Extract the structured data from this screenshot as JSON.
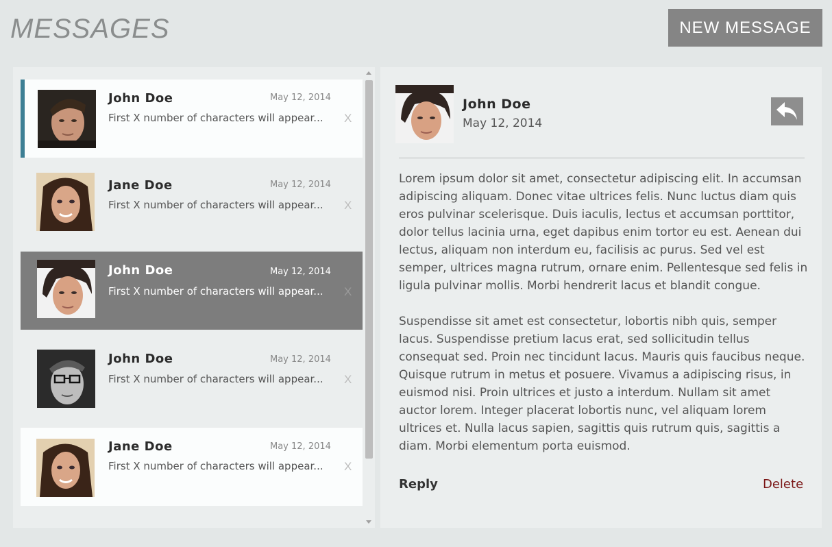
{
  "header": {
    "title": "MESSAGES",
    "new_message_label": "NEW MESSAGE"
  },
  "messages": [
    {
      "name": "John Doe",
      "date": "May 12, 2014",
      "preview": "First X number of characters will appear...",
      "close": "X",
      "avatar": "man-avatar-1"
    },
    {
      "name": "Jane Doe",
      "date": "May 12, 2014",
      "preview": "First X number of characters will appear...",
      "close": "X",
      "avatar": "woman-avatar"
    },
    {
      "name": "John Doe",
      "date": "May 12, 2014",
      "preview": "First X number of characters will appear...",
      "close": "X",
      "avatar": "man-avatar-2"
    },
    {
      "name": "John Doe",
      "date": "May 12, 2014",
      "preview": "First X number of characters will appear...",
      "close": "X",
      "avatar": "man-glasses-avatar"
    },
    {
      "name": "Jane Doe",
      "date": "May 12, 2014",
      "preview": "First X number of characters will appear...",
      "close": "X",
      "avatar": "woman-avatar"
    }
  ],
  "detail": {
    "name": "John Doe",
    "date": "May 12, 2014",
    "paragraphs": [
      "Lorem ipsum dolor sit amet, consectetur adipiscing elit. In accumsan adipiscing aliquam. Donec vitae ultrices felis. Nunc luctus diam quis eros pulvinar scelerisque. Duis iaculis, lectus et accumsan porttitor, dolor tellus lacinia urna, eget dapibus enim tortor eu est. Aenean dui lectus, aliquam non interdum eu, facilisis ac purus. Sed vel est semper, ultrices magna rutrum, ornare enim. Pellentesque sed felis in ligula pulvinar mollis. Morbi hendrerit lacus et blandit congue.",
      "Suspendisse sit amet est consectetur, lobortis nibh quis, semper lacus. Suspendisse pretium lacus erat, sed sollicitudin tellus consequat sed. Proin nec tincidunt lacus. Mauris quis faucibus neque. Quisque rutrum in metus et posuere. Vivamus a adipiscing risus, in euismod nisi. Proin ultrices et justo a interdum. Nullam sit amet auctor lorem. Integer placerat lobortis nunc, vel aliquam lorem ultrices et. Nulla lacus sapien, sagittis quis rutrum quis, sagittis a diam. Morbi elementum porta euismod."
    ],
    "reply_label": "Reply",
    "delete_label": "Delete"
  },
  "colors": {
    "accent": "#3d7f94",
    "selected_bg": "#7d7d7d",
    "delete": "#7a1515"
  }
}
